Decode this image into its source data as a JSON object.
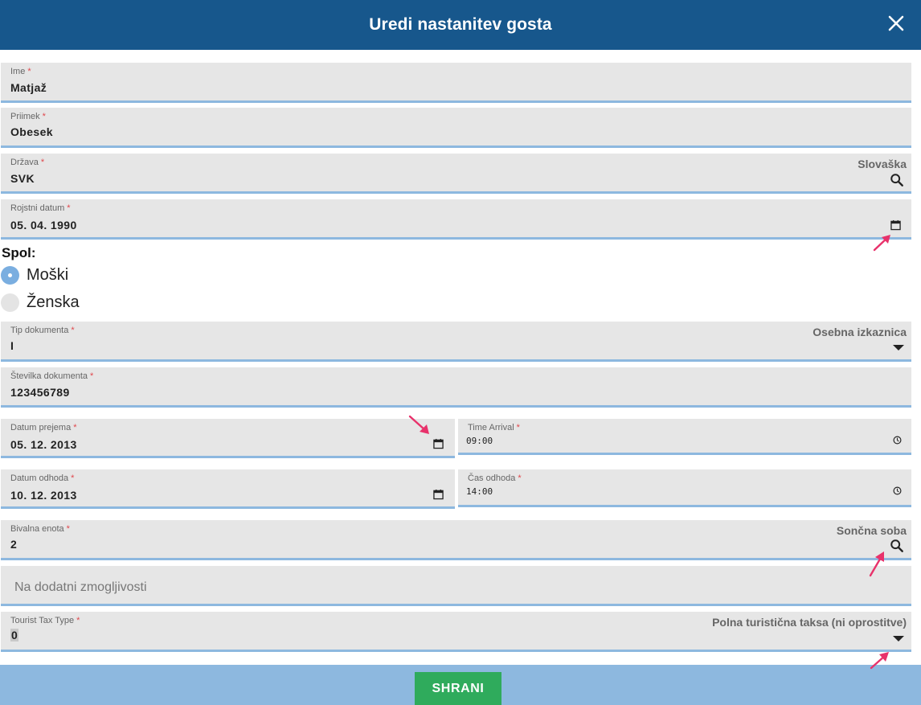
{
  "header": {
    "title": "Uredi nastanitev gosta"
  },
  "fields": {
    "ime": {
      "label": "Ime",
      "value": "Matjaž"
    },
    "priimek": {
      "label": "Priimek",
      "value": "Obesek"
    },
    "drzava": {
      "label": "Država",
      "value": "SVK",
      "lookup": "Slovaška"
    },
    "rojstni": {
      "label": "Rojstni datum",
      "value": "05. 04. 1990"
    },
    "tip_dok": {
      "label": "Tip dokumenta",
      "value": "I",
      "selected": "Osebna izkaznica"
    },
    "stev_dok": {
      "label": "Številka dokumenta",
      "value": "123456789"
    },
    "datum_prejema": {
      "label": "Datum prejema",
      "value": "05. 12. 2013"
    },
    "time_arrival": {
      "label": "Time Arrival",
      "value": "09:00"
    },
    "datum_odhoda": {
      "label": "Datum odhoda",
      "value": "10. 12. 2013"
    },
    "cas_odhoda": {
      "label": "Čas odhoda",
      "value": "14:00"
    },
    "bivalna": {
      "label": "Bivalna enota",
      "value": "2",
      "lookup": "Sončna soba"
    },
    "dodatni": {
      "placeholder": "Na dodatni zmogljivosti"
    },
    "tourist_tax": {
      "label": "Tourist Tax Type",
      "value": "0",
      "selected": "Polna turistična taksa (ni oprostitve)"
    }
  },
  "spol": {
    "label": "Spol:",
    "options": [
      "Moški",
      "Ženska"
    ],
    "selected": "Moški"
  },
  "required_mark": "*",
  "footer": {
    "save_label": "SHRANI"
  },
  "colors": {
    "header_bg": "#17578c",
    "field_bg": "#e6e6e6",
    "field_underline": "#8db8df",
    "required": "#e0474c",
    "save_button": "#2fab5c",
    "footer_bg": "#8db8df",
    "annotation_arrow": "#e8326b"
  }
}
